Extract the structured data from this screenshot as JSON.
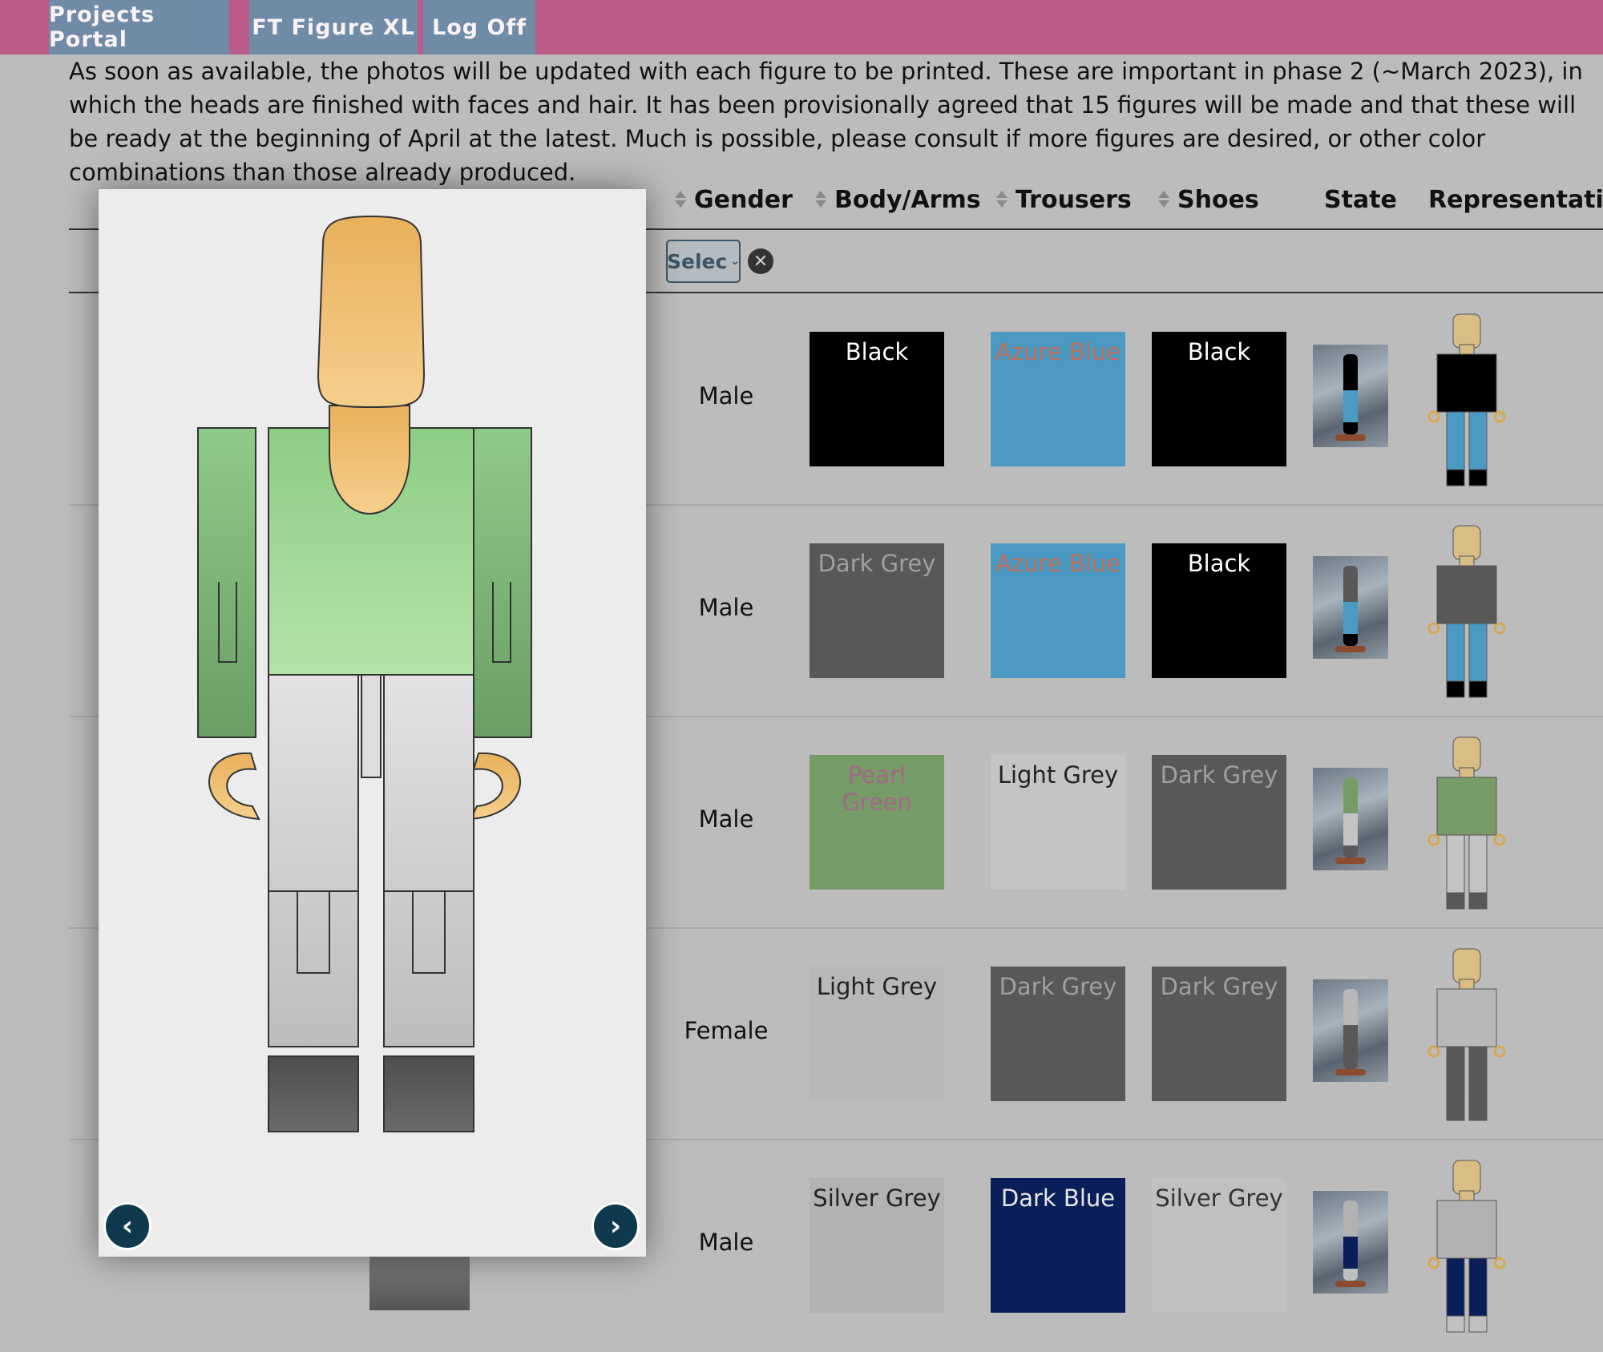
{
  "nav": {
    "tabs": [
      {
        "label": "Projects Portal"
      },
      {
        "label": "FT Figure XL"
      },
      {
        "label": "Log Off"
      }
    ]
  },
  "intro_text": "As soon as available, the photos will be updated with each figure to be printed. These are important in phase 2 (~March 2023), in which the heads are finished with faces and hair. It has been provisionally agreed that 15 figures will be made and that these will be ready at the beginning of April at the latest. Much is possible, please consult if more figures are desired, or other color combinations than those already produced.",
  "table": {
    "headers": {
      "gender": "Gender",
      "body": "Body/Arms",
      "trousers": "Trousers",
      "shoes": "Shoes",
      "state": "State",
      "representation": "Representation"
    },
    "filter": {
      "select_label": "Selec"
    },
    "rows": [
      {
        "gender": "Male",
        "body": {
          "name": "Black",
          "color": "#000000",
          "text": "#ffffff"
        },
        "trousers": {
          "name": "Azure Blue",
          "color": "#4a9ac4",
          "text": "#c0705a"
        },
        "shoes": {
          "name": "Black",
          "color": "#000000",
          "text": "#ffffff"
        }
      },
      {
        "gender": "Male",
        "body": {
          "name": "Dark Grey",
          "color": "#585858",
          "text": "#a0a0a0"
        },
        "trousers": {
          "name": "Azure Blue",
          "color": "#4a9ac4",
          "text": "#c0705a"
        },
        "shoes": {
          "name": "Black",
          "color": "#000000",
          "text": "#ffffff"
        }
      },
      {
        "gender": "Male",
        "body": {
          "name": "Pearl Green",
          "color": "#779b66",
          "text": "#a06a8a"
        },
        "trousers": {
          "name": "Light Grey",
          "color": "#c4c4c4",
          "text": "#222222"
        },
        "shoes": {
          "name": "Dark Grey",
          "color": "#585858",
          "text": "#a0a0a0"
        }
      },
      {
        "gender": "Female",
        "body": {
          "name": "Light Grey",
          "color": "#b8b8b8",
          "text": "#222222"
        },
        "trousers": {
          "name": "Dark Grey",
          "color": "#585858",
          "text": "#a0a0a0"
        },
        "shoes": {
          "name": "Dark Grey",
          "color": "#585858",
          "text": "#a0a0a0"
        }
      },
      {
        "gender": "Male",
        "body": {
          "name": "Silver Grey",
          "color": "#b2b2b2",
          "text": "#222222"
        },
        "trousers": {
          "name": "Dark Blue",
          "color": "#0a1f5a",
          "text": "#e6e6e6"
        },
        "shoes": {
          "name": "Silver Grey",
          "color": "#c0c0c0",
          "text": "#333333"
        }
      }
    ]
  },
  "modal": {
    "figure_colors": {
      "skin": "#eebb66",
      "body": "#a8dca0",
      "trousers": "#d8d8d8",
      "shoes": "#5a5a5a"
    }
  }
}
